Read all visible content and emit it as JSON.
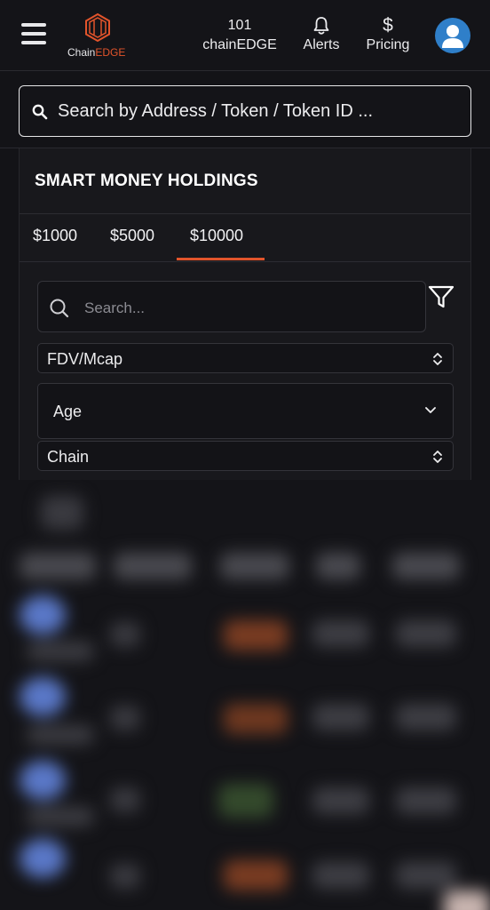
{
  "header": {
    "logo_text_a": "Chain",
    "logo_text_b": "EDGE",
    "nav": [
      {
        "top": "101",
        "label": "chainEDGE"
      },
      {
        "icon": "bell-icon",
        "label": "Alerts"
      },
      {
        "top": "$",
        "label": "Pricing"
      }
    ]
  },
  "search": {
    "placeholder": "Search by Address / Token / Token ID ..."
  },
  "holdings": {
    "title": "SMART MONEY HOLDINGS",
    "tabs": [
      "$1000",
      "$5000",
      "$10000"
    ],
    "active_tab": "$10000",
    "search_placeholder": "Search...",
    "filters": {
      "fdv": "FDV/Mcap",
      "age": "Age",
      "chain": "Chain"
    }
  },
  "colors": {
    "accent": "#e2542b",
    "background": "#131317",
    "card": "#18181c",
    "avatar": "#2f7fc9"
  }
}
